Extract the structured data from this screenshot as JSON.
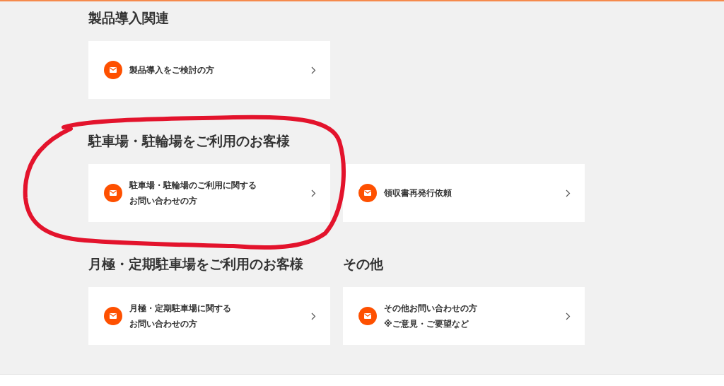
{
  "rows": [
    [
      {
        "heading": "製品導入関連",
        "cards": [
          {
            "lines": [
              "製品導入をご検討の方"
            ]
          }
        ]
      }
    ],
    [
      {
        "heading": "駐車場・駐輪場をご利用のお客様",
        "cards": [
          {
            "lines": [
              "駐車場・駐輪場のご利用に関する",
              "お問い合わせの方"
            ]
          },
          {
            "lines": [
              "領収書再発行依頼"
            ]
          }
        ]
      }
    ],
    [
      {
        "heading": "月極・定期駐車場をご利用のお客様",
        "cards": [
          {
            "lines": [
              "月極・定期駐車場に関する",
              "お問い合わせの方"
            ]
          }
        ]
      },
      {
        "heading": "その他",
        "cards": [
          {
            "lines": [
              "その他お問い合わせの方",
              "※ご意見・ご要望など"
            ]
          }
        ]
      }
    ]
  ]
}
